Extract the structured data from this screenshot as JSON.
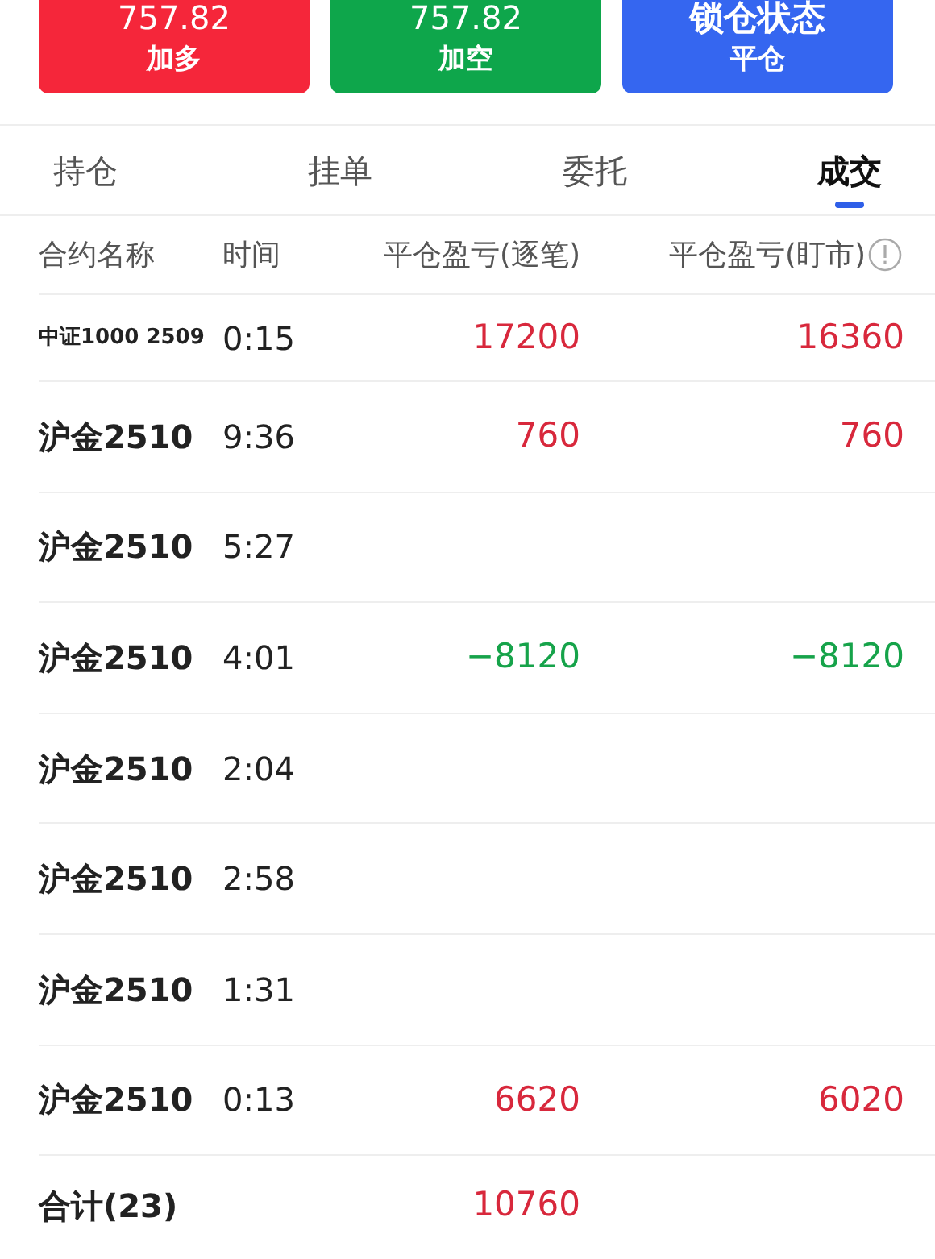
{
  "actions": [
    {
      "kind": "long",
      "value": "757.82",
      "label": "加多"
    },
    {
      "kind": "short",
      "value": "757.82",
      "label": "加空"
    },
    {
      "kind": "lock",
      "value": "锁仓状态",
      "label": "平仓"
    }
  ],
  "tabs": [
    {
      "label": "持仓",
      "selected": false
    },
    {
      "label": "挂单",
      "selected": false
    },
    {
      "label": "委托",
      "selected": false
    },
    {
      "label": "成交",
      "selected": true
    }
  ],
  "table": {
    "columns": [
      "合约名称",
      "时间",
      "平仓盈亏(逐笔)",
      "平仓盈亏(盯市)"
    ],
    "rows": [
      {
        "kind": "compact",
        "name": "中证1000 2509",
        "time": "0:15",
        "pnl_trade": {
          "text": "17200",
          "kind": "profit"
        },
        "pnl_mark": {
          "text": "16360",
          "kind": "profit"
        }
      },
      {
        "kind": "normal",
        "name": "沪金2510",
        "time": "9:36",
        "pnl_trade": {
          "text": "760",
          "kind": "profit"
        },
        "pnl_mark": {
          "text": "760",
          "kind": "profit"
        }
      },
      {
        "kind": "normal",
        "name": "沪金2510",
        "time": "5:27"
      },
      {
        "kind": "normal",
        "name": "沪金2510",
        "time": "4:01",
        "pnl_trade": {
          "text": "−8120",
          "kind": "loss"
        },
        "pnl_mark": {
          "text": "−8120",
          "kind": "loss"
        }
      },
      {
        "kind": "normal",
        "name": "沪金2510",
        "time": "2:04"
      },
      {
        "kind": "normal",
        "name": "沪金2510",
        "time": "2:58"
      },
      {
        "kind": "normal",
        "name": "沪金2510",
        "time": "1:31"
      },
      {
        "kind": "normal",
        "name": "沪金2510",
        "time": "0:13",
        "pnl_trade": {
          "text": "6620",
          "kind": "profit"
        },
        "pnl_mark": {
          "text": "6020",
          "kind": "profit"
        }
      }
    ],
    "total": {
      "label": "合计(23)",
      "pnl_trade": {
        "text": "10760",
        "kind": "profit"
      }
    }
  }
}
